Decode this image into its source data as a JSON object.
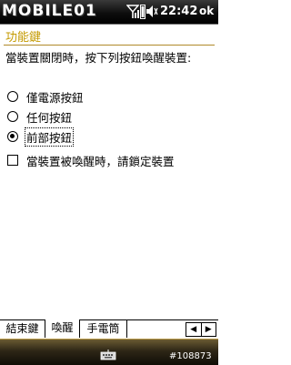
{
  "status_bar": {
    "brand": "MOBILE01",
    "time": "22:42",
    "ok_label": "ok",
    "icons": [
      "signal-icon",
      "battery-charge-icon",
      "volume-icon"
    ]
  },
  "header": {
    "title": "功能鍵"
  },
  "description": "當裝置關閉時，按下列按鈕喚醒裝置:",
  "options": [
    {
      "label": "僅電源按鈕",
      "selected": false
    },
    {
      "label": "任何按鈕",
      "selected": false
    },
    {
      "label": "前部按鈕",
      "selected": true
    }
  ],
  "lock_checkbox": {
    "label": "當裝置被喚醒時，請鎖定裝置",
    "checked": false
  },
  "tabs": [
    {
      "label": "結束鍵",
      "active": false
    },
    {
      "label": "喚醒",
      "active": true
    },
    {
      "label": "手電筒",
      "active": false
    }
  ],
  "footer_code": "#108873",
  "colors": {
    "accent": "#c49a00",
    "tab_border": "#000000"
  }
}
